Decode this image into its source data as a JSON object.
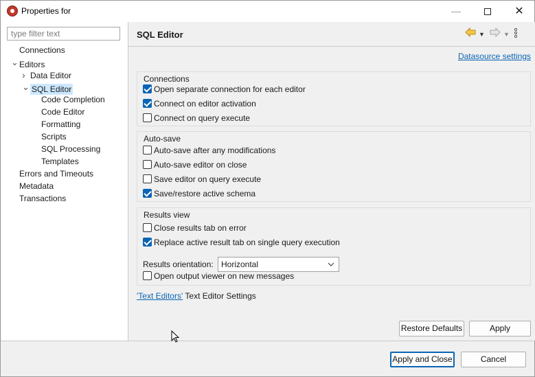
{
  "window": {
    "title": "Properties for",
    "minimize_icon": "minimize-icon",
    "maximize_icon": "maximize-icon",
    "close_glyph": "✕"
  },
  "filter": {
    "placeholder": "type filter text",
    "value": ""
  },
  "tree": [
    {
      "label": "Connections",
      "level": 0,
      "arrow": ""
    },
    {
      "label": "Editors",
      "level": 0,
      "arrow": "expanded"
    },
    {
      "label": "Data Editor",
      "level": 1,
      "arrow": "collapsed"
    },
    {
      "label": "SQL Editor",
      "level": 1,
      "arrow": "expanded",
      "selected": true
    },
    {
      "label": "Code Completion",
      "level": 2,
      "arrow": ""
    },
    {
      "label": "Code Editor",
      "level": 2,
      "arrow": ""
    },
    {
      "label": "Formatting",
      "level": 2,
      "arrow": ""
    },
    {
      "label": "Scripts",
      "level": 2,
      "arrow": ""
    },
    {
      "label": "SQL Processing",
      "level": 2,
      "arrow": ""
    },
    {
      "label": "Templates",
      "level": 2,
      "arrow": ""
    },
    {
      "label": "Errors and Timeouts",
      "level": 0,
      "arrow": ""
    },
    {
      "label": "Metadata",
      "level": 0,
      "arrow": ""
    },
    {
      "label": "Transactions",
      "level": 0,
      "arrow": ""
    }
  ],
  "page": {
    "title": "SQL Editor",
    "datasource_link": "Datasource settings",
    "groups": {
      "connections": {
        "legend": "Connections",
        "items": [
          {
            "label": "Open separate connection for each editor",
            "checked": true
          },
          {
            "label": "Connect on editor activation",
            "checked": true
          },
          {
            "label": "Connect on query execute",
            "checked": false
          }
        ]
      },
      "autosave": {
        "legend": "Auto-save",
        "items": [
          {
            "label": "Auto-save after any modifications",
            "checked": false
          },
          {
            "label": "Auto-save editor on close",
            "checked": false
          },
          {
            "label": "Save editor on query execute",
            "checked": false
          },
          {
            "label": "Save/restore active schema",
            "checked": true
          }
        ]
      },
      "results": {
        "legend": "Results view",
        "items": [
          {
            "label": "Close results tab on error",
            "checked": false
          },
          {
            "label": "Replace active result tab on single query execution",
            "checked": true
          }
        ],
        "orientation_label": "Results orientation:",
        "orientation_value": "Horizontal",
        "output_viewer": {
          "label": "Open output viewer on new messages",
          "checked": false
        }
      }
    },
    "text_editors_link": "'Text Editors'",
    "text_editors_suffix": " Text Editor Settings"
  },
  "buttons": {
    "restore_defaults": "Restore Defaults",
    "apply": "Apply",
    "apply_and_close": "Apply and Close",
    "cancel": "Cancel"
  },
  "colors": {
    "accent": "#0a64b4",
    "selection": "#cce8ff",
    "back_arrow": "#e8b020"
  }
}
